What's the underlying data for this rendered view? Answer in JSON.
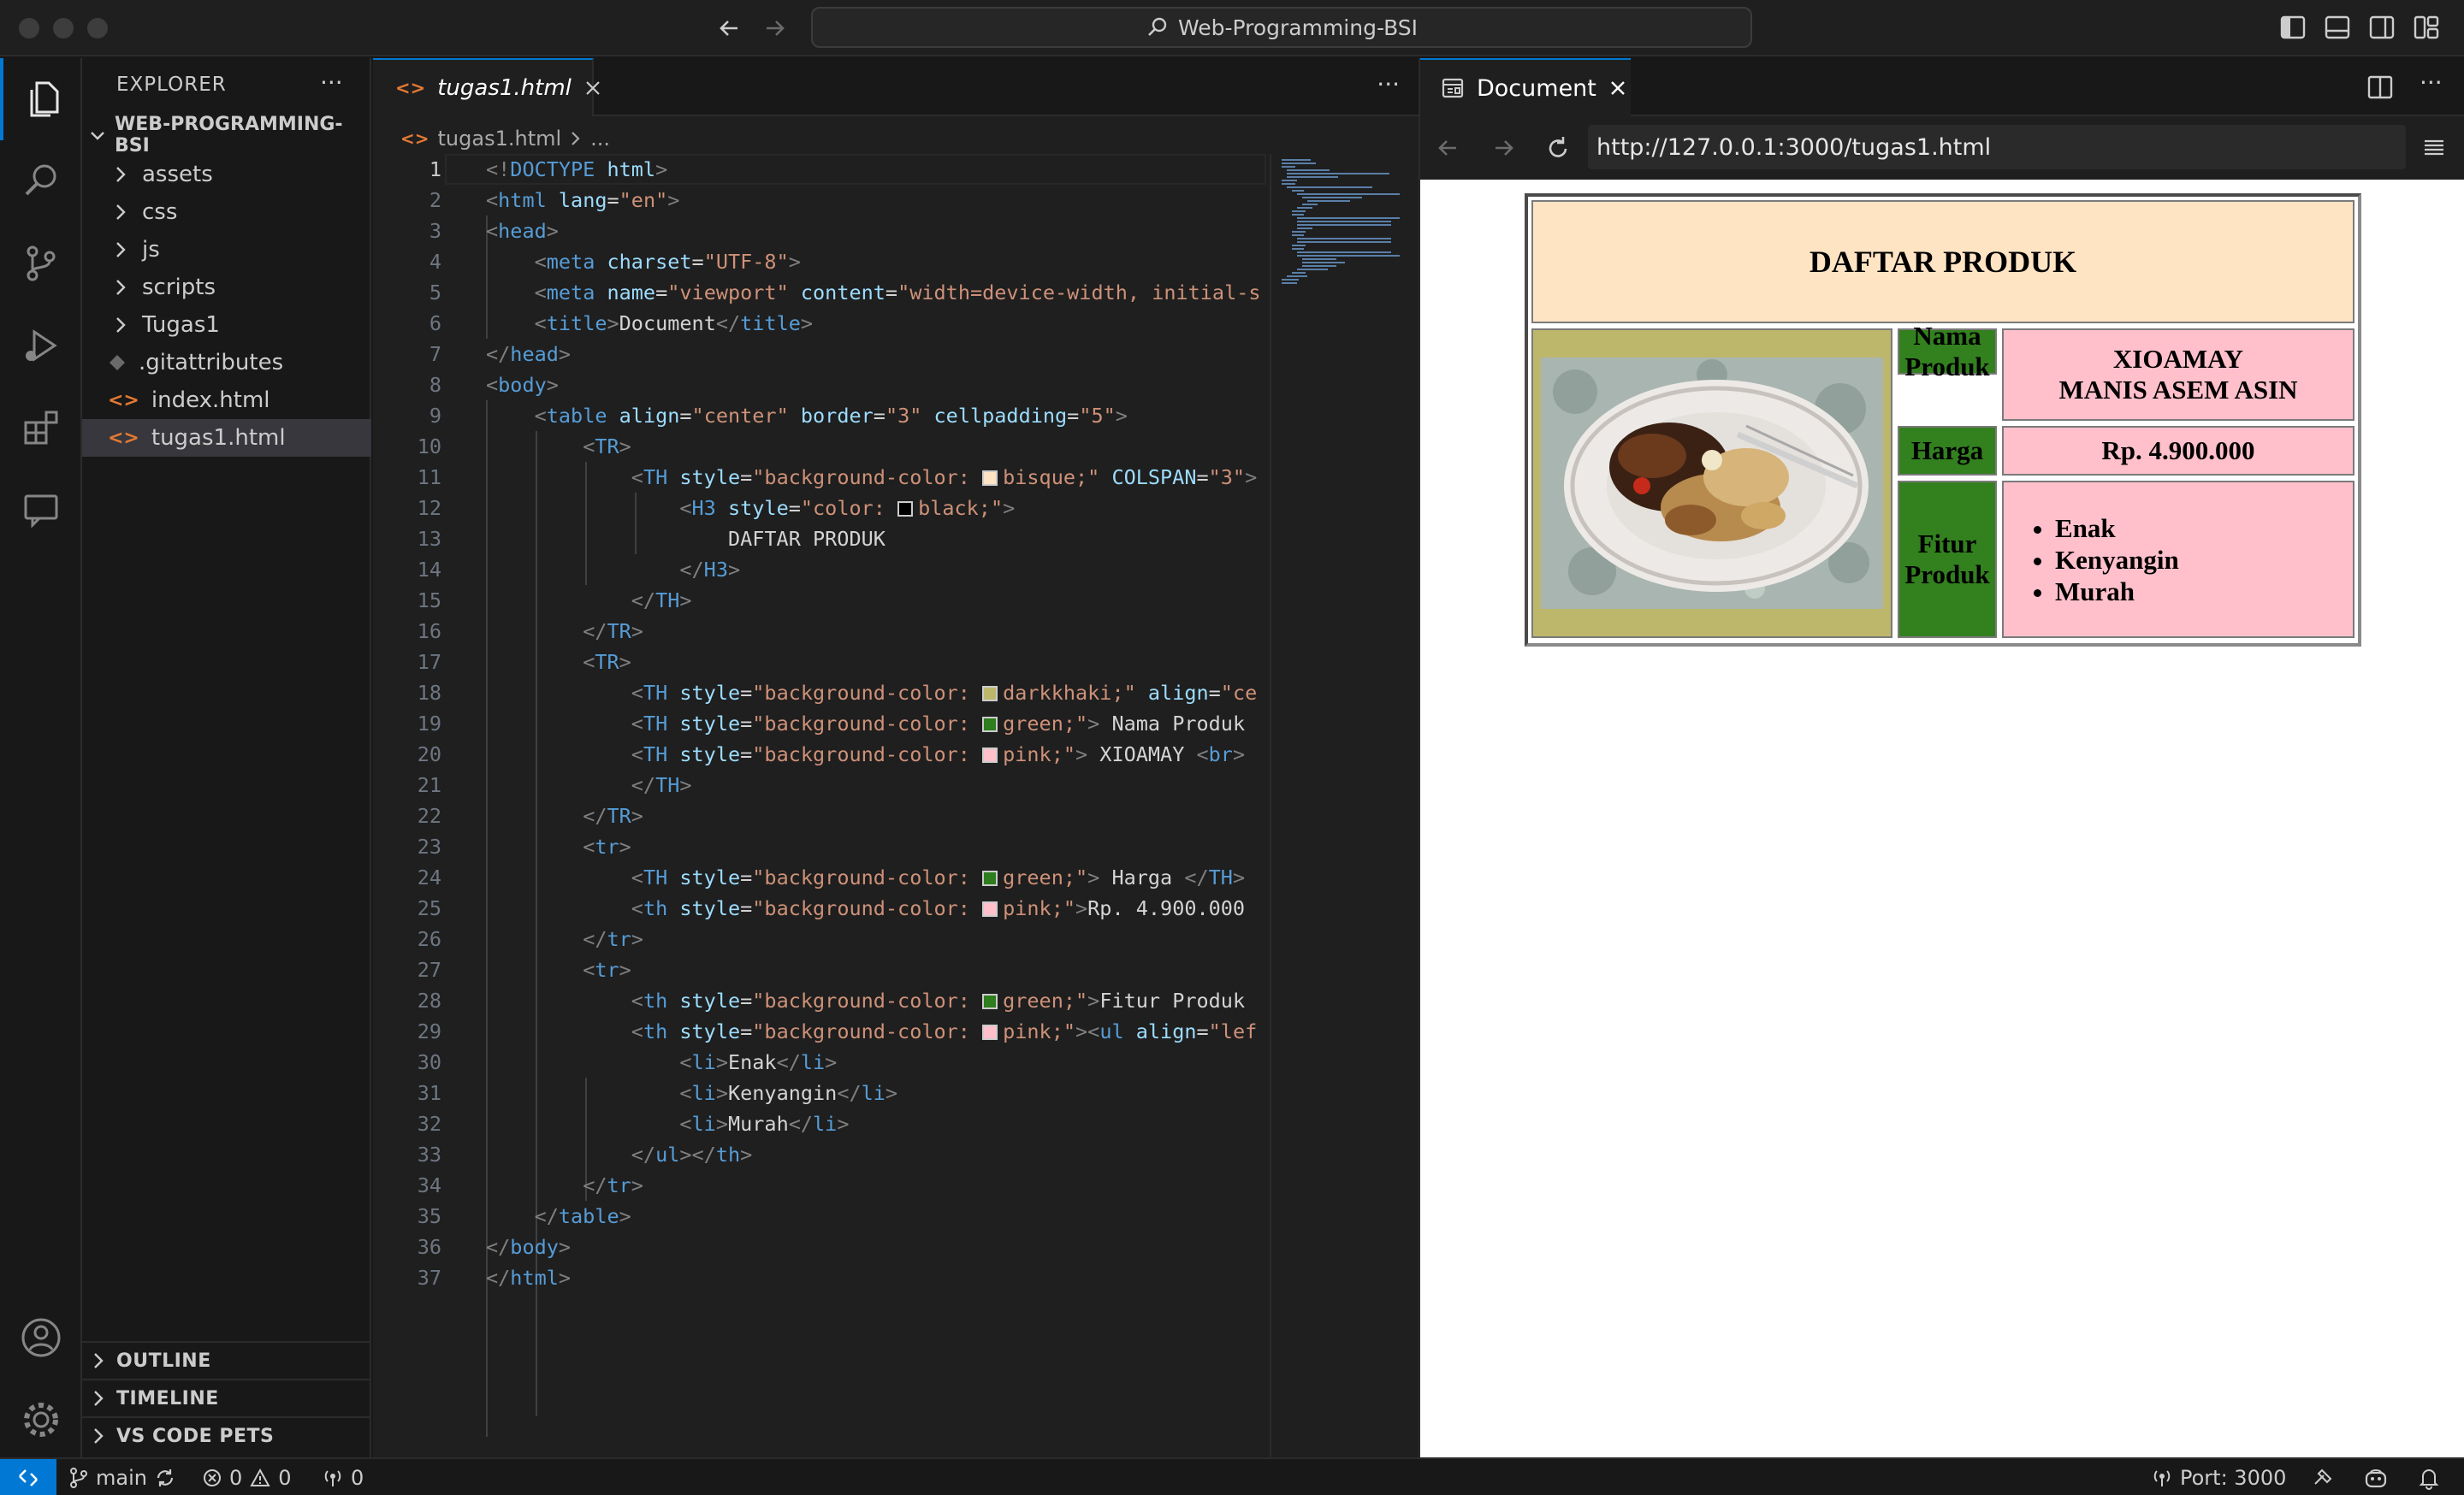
{
  "window": {
    "search_text": "Web-Programming-BSI"
  },
  "sidebar": {
    "title": "EXPLORER",
    "more": "···",
    "root": "WEB-PROGRAMMING-BSI",
    "folders": [
      "assets",
      "css",
      "js",
      "scripts",
      "Tugas1"
    ],
    "files": [
      ".gitattributes",
      "index.html",
      "tugas1.html"
    ],
    "sections": [
      "OUTLINE",
      "TIMELINE",
      "VS CODE PETS"
    ]
  },
  "editor": {
    "tab_label": "tugas1.html",
    "breadcrumb": {
      "file": "tugas1.html",
      "more": "..."
    },
    "more": "···",
    "colors": {
      "bisque": "#ffe4c4",
      "black": "#000000",
      "darkkhaki": "#bdb76b",
      "green": "#2e7d1e",
      "pink": "#ffc0cb"
    },
    "lines": [
      "<!DOCTYPE html>",
      "<html lang=\"en\">",
      "<head>",
      "    <meta charset=\"UTF-8\">",
      "    <meta name=\"viewport\" content=\"width=device-width, initial-s",
      "    <title>Document</title>",
      "</head>",
      "<body>",
      "    <table align=\"center\" border=\"3\" cellpadding=\"5\">",
      "        <TR>",
      "            <TH style=\"background-color: bisque;\" COLSPAN=\"3\">",
      "                <H3 style=\"color: black;\">",
      "                    DAFTAR PRODUK",
      "                </H3>",
      "            </TH>",
      "        </TR>",
      "        <TR>",
      "            <TH style=\"background-color: darkkhaki;\" align=\"ce",
      "            <TH style=\"background-color: green;\"> Nama Produk<",
      "            <TH style=\"background-color: pink;\"> XIOAMAY <br> ",
      "            </TH>",
      "        </TR>",
      "        <tr>",
      "            <TH style=\"background-color: green;\"> Harga </TH>",
      "            <th style=\"background-color: pink;\">Rp. 4.900.000<",
      "        </tr>",
      "        <tr>",
      "            <th style=\"background-color: green;\">Fitur Produk<",
      "            <th style=\"background-color: pink;\"><ul align=\"lef",
      "                <li>Enak</li>",
      "                <li>Kenyangin</li>",
      "                <li>Murah</li>",
      "            </ul></th>",
      "        </tr>",
      "    </table>",
      "</body>",
      "</html>"
    ]
  },
  "preview": {
    "tab_label": "Document",
    "url": "http://127.0.0.1:3000/tugas1.html",
    "table": {
      "heading": "DAFTAR PRODUK",
      "name_label": "Nama Produk",
      "name_value_line1": "XIOAMAY",
      "name_value_line2": "MANIS ASEM ASIN",
      "price_label": "Harga",
      "price_value": "Rp. 4.900.000",
      "features_label": "Fitur Produk",
      "features": [
        "Enak",
        "Kenyangin",
        "Murah"
      ],
      "colors": {
        "heading_bg": "#ffe4c4",
        "image_bg": "#bdb76b",
        "label_bg": "#33801f",
        "value_bg": "#ffc0cb"
      }
    }
  },
  "status": {
    "branch": "main",
    "errors": "0",
    "warnings": "0",
    "ports_count": "0",
    "port": "Port: 3000"
  }
}
